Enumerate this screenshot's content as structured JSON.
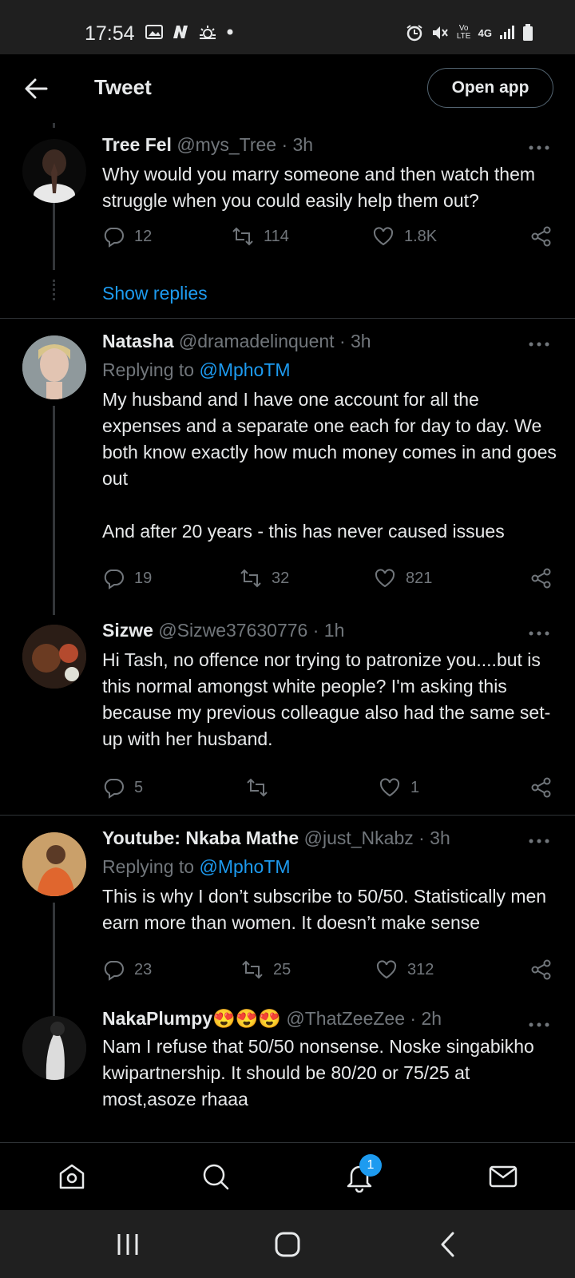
{
  "status_bar": {
    "time": "17:54",
    "left_icons": [
      "gallery-icon",
      "n-icon",
      "weather-icon",
      "dot-icon"
    ],
    "right_icons": [
      "alarm-icon",
      "mute-icon",
      "volte-icon",
      "4g-icon",
      "signal-icon",
      "battery-icon"
    ],
    "right_text": {
      "volte": "Vo LTE",
      "network": "4G"
    }
  },
  "header": {
    "title": "Tweet",
    "open_app_label": "Open app"
  },
  "tweets": [
    {
      "name": "Tree Fel",
      "handle": "@mys_Tree",
      "time": "· 3h",
      "text": "Why would you marry someone and then watch them struggle when you could easily help them out?",
      "replies": "12",
      "retweets": "114",
      "likes": "1.8K",
      "show_replies": "Show replies"
    },
    {
      "name": "Natasha",
      "handle": "@dramadelinquent",
      "time": "· 3h",
      "replying_prefix": "Replying to ",
      "replying_to": "@MphoTM",
      "text": "My husband and I have one account for all the expenses and a separate one each for day to day. We both know exactly how much money comes in and goes out\n\nAnd after 20 years - this has never caused issues",
      "replies": "19",
      "retweets": "32",
      "likes": "821"
    },
    {
      "name": "Sizwe",
      "handle": "@Sizwe37630776",
      "time": "· 1h",
      "text": "Hi Tash, no offence nor trying to patronize you....but is this normal amongst white people? I'm asking this because my previous colleague also had the same set-up with her husband.",
      "replies": "5",
      "retweets": "",
      "likes": "1"
    },
    {
      "name": "Youtube: Nkaba Mathe",
      "handle": "@just_Nkabz",
      "time": "· 3h",
      "replying_prefix": "Replying to ",
      "replying_to": "@MphoTM",
      "text": "This is why I don’t subscribe to 50/50. Statistically men earn more than women. It doesn’t make sense",
      "replies": "23",
      "retweets": "25",
      "likes": "312"
    },
    {
      "name": "NakaPlumpy",
      "name_emoji": "😍😍😍",
      "handle": "@ThatZeeZee",
      "time": "· 2h",
      "text": "Nam I refuse that 50/50 nonsense. Noske singabikho kwipartnership. It should be 80/20 or 75/25 at most,asoze rhaaa"
    }
  ],
  "bottom_nav": {
    "items": [
      "home-icon",
      "search-icon",
      "notifications-icon",
      "messages-icon"
    ],
    "notification_badge": "1"
  },
  "system_nav": [
    "recents-icon",
    "home-button-icon",
    "back-icon"
  ],
  "colors": {
    "background": "#000000",
    "accent": "#1d9bf0",
    "secondary_text": "#71767b",
    "primary_text": "#e7e9ea"
  }
}
